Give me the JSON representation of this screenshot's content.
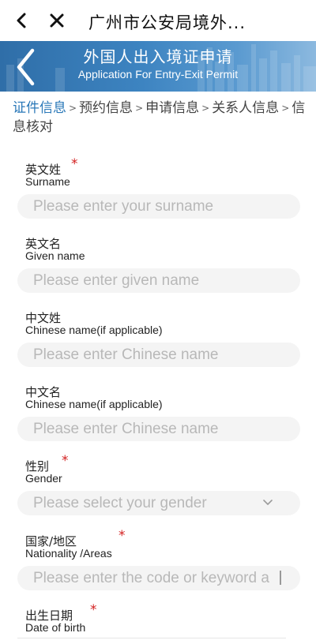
{
  "browser": {
    "title": "广州市公安局境外..."
  },
  "banner": {
    "title_cn": "外国人出入境证申请",
    "title_en": "Application For Entry-Exit Permit"
  },
  "breadcrumb": {
    "steps": [
      "证件信息",
      "预约信息",
      "申请信息",
      "关系人信息",
      "信息核对"
    ],
    "separator": ">",
    "active_index": 0
  },
  "form": {
    "fields": [
      {
        "label_cn": "英文姓",
        "label_en": "Surname",
        "required": true,
        "placeholder": "Please enter your surname",
        "value": ""
      },
      {
        "label_cn": "英文名",
        "label_en": "Given name",
        "required": false,
        "placeholder": "Please enter given name",
        "value": ""
      },
      {
        "label_cn": "中文姓",
        "label_en": "Chinese name(if applicable)",
        "required": false,
        "placeholder": "Please enter Chinese name",
        "value": ""
      },
      {
        "label_cn": "中文名",
        "label_en": "Chinese name(if applicable)",
        "required": false,
        "placeholder": "Please enter Chinese name",
        "value": ""
      },
      {
        "label_cn": "性别",
        "label_en": "Gender",
        "required": true,
        "placeholder": "Please select your gender",
        "value": ""
      },
      {
        "label_cn": "国家/地区",
        "label_en": "Nationality /Areas",
        "required": true,
        "placeholder": "Please enter the code or keyword a",
        "value": ""
      },
      {
        "label_cn": "出生日期",
        "label_en": "Date of birth",
        "required": true
      }
    ],
    "required_mark": "*"
  },
  "colors": {
    "accent": "#2a78b8",
    "required": "#d32020",
    "banner": "#3d84c1",
    "input_bg": "#f4f4f4"
  },
  "icons": {
    "browser_back": "arrow-left-icon",
    "browser_close": "close-icon",
    "banner_back": "chevron-left-icon",
    "select": "chevron-down-icon"
  }
}
